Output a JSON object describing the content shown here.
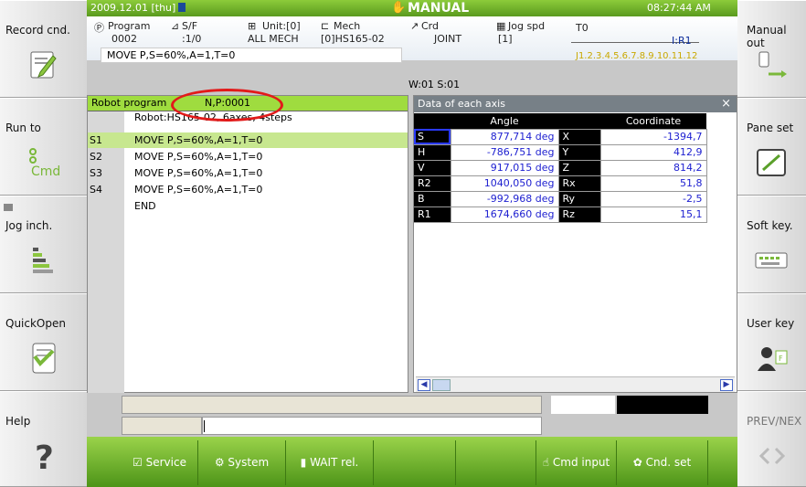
{
  "header": {
    "datetime": "2009.12.01 [thu]",
    "mode": "MANUAL",
    "clock": "08:27:44 AM"
  },
  "info": {
    "program_label": "Program",
    "program_value": "0002",
    "sf_label": "S/F",
    "sf_value": ":1/0",
    "unit_label": "Unit:[0]",
    "unit_value": "ALL MECH",
    "mech_label": "Mech",
    "mech_value": "[0]HS165-02",
    "crd_label": "Crd",
    "crd_value": "JOINT",
    "jogspd_label": "Jog spd",
    "jogspd_value": "[1]",
    "t_label": "T0",
    "r_label": "I:R1",
    "joints": "J1.2.3.4.5.6.7.8.9.10.11.12",
    "cmd": "MOVE P,S=60%,A=1,T=0",
    "w": "W:01 S:01"
  },
  "left_buttons": [
    {
      "label": "Record cnd."
    },
    {
      "label": "Run to"
    },
    {
      "label": "Jog inch."
    },
    {
      "label": "QuickOpen"
    },
    {
      "label": "Help"
    }
  ],
  "right_buttons": [
    {
      "label": "Manual out"
    },
    {
      "label": "Pane set"
    },
    {
      "label": "Soft key."
    },
    {
      "label": "User key"
    },
    {
      "label": "PREV/NEX"
    }
  ],
  "program": {
    "title": "Robot program",
    "np": "N,P:0001",
    "subtitle": "Robot:HS165-02, 6axes, 4steps",
    "lines": [
      {
        "step": "S1",
        "text": "MOVE P,S=60%,A=1,T=0"
      },
      {
        "step": "S2",
        "text": "MOVE P,S=60%,A=1,T=0"
      },
      {
        "step": "S3",
        "text": "MOVE P,S=60%,A=1,T=0"
      },
      {
        "step": "S4",
        "text": "MOVE P,S=60%,A=1,T=0"
      },
      {
        "step": "",
        "text": "END"
      }
    ]
  },
  "axis": {
    "title": "Data of each axis",
    "angle_header": "Angle",
    "coord_header": "Coordinate",
    "rows": [
      {
        "axis": "S",
        "angle": "877,714 deg",
        "cname": "X",
        "coord": "-1394,7"
      },
      {
        "axis": "H",
        "angle": "-786,751 deg",
        "cname": "Y",
        "coord": "412,9"
      },
      {
        "axis": "V",
        "angle": "917,015 deg",
        "cname": "Z",
        "coord": "814,2"
      },
      {
        "axis": "R2",
        "angle": "1040,050 deg",
        "cname": "Rx",
        "coord": "51,8"
      },
      {
        "axis": "B",
        "angle": "-992,968 deg",
        "cname": "Ry",
        "coord": "-2,5"
      },
      {
        "axis": "R1",
        "angle": "1674,660 deg",
        "cname": "Rz",
        "coord": "15,1"
      }
    ]
  },
  "menu": {
    "service": "Service",
    "system": "System",
    "wait": "WAIT rel.",
    "cmd_input": "Cmd input",
    "cnd_set": "Cnd. set"
  },
  "colors": {
    "accent": "#6ab42a",
    "highlight": "#e21a1a"
  }
}
